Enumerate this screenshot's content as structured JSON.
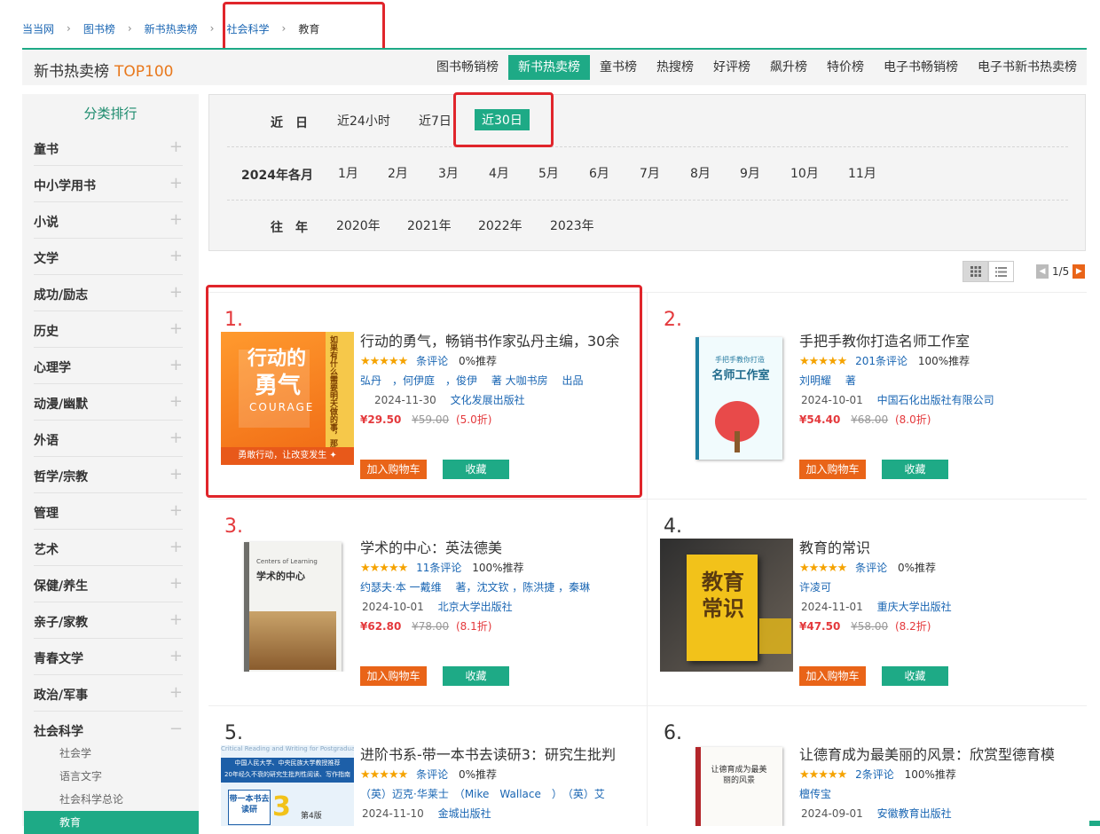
{
  "breadcrumb": [
    "当当网",
    "图书榜",
    "新书热卖榜",
    "社会科学",
    "教育"
  ],
  "header": {
    "title": "新书热卖榜",
    "top": "TOP100"
  },
  "tabs": [
    "图书畅销榜",
    "新书热卖榜",
    "童书榜",
    "热搜榜",
    "好评榜",
    "飙升榜",
    "特价榜",
    "电子书畅销榜",
    "电子书新书热卖榜"
  ],
  "active_tab": "新书热卖榜",
  "sidebar": {
    "title": "分类排行",
    "items": [
      "童书",
      "中小学用书",
      "小说",
      "文学",
      "成功/励志",
      "历史",
      "心理学",
      "动漫/幽默",
      "外语",
      "哲学/宗教",
      "管理",
      "艺术",
      "保健/养生",
      "亲子/家教",
      "青春文学",
      "政治/军事",
      "社会科学"
    ],
    "expanded": "社会科学",
    "subitems": [
      "社会学",
      "语言文字",
      "社会科学总论",
      "教育"
    ],
    "active_sub": "教育"
  },
  "filter": {
    "recent_label": "近　日",
    "recent": [
      "近24小时",
      "近7日",
      "近30日"
    ],
    "recent_active": "近30日",
    "month_label": "2024年各月",
    "months": [
      "1月",
      "2月",
      "3月",
      "4月",
      "5月",
      "6月",
      "7月",
      "8月",
      "9月",
      "10月",
      "11月"
    ],
    "year_label": "往　年",
    "years": [
      "2020年",
      "2021年",
      "2022年",
      "2023年"
    ]
  },
  "pager": {
    "text": "1/5"
  },
  "colors": {
    "accent": "#1eaa86",
    "price": "#e4393c",
    "cart": "#e96418",
    "highlight": "#e0252b"
  },
  "buttons": {
    "cart": "加入购物车",
    "fav": "收藏"
  },
  "books": [
    {
      "rank": "1.",
      "title": "行动的勇气，畅销书作家弘丹主编，30余",
      "rating": 5,
      "reviews": "条评论",
      "recommend": "0%推荐",
      "authors": "弘丹　，何伊庭　，俊伊　 著 大咖书房　 出品",
      "date": "2024-11-30",
      "publisher": "文化发展出版社",
      "price": "¥29.50",
      "orig": "¥59.00",
      "discount": "(5.0折)"
    },
    {
      "rank": "2.",
      "title": "手把手教你打造名师工作室",
      "rating": 5,
      "reviews": "201条评论",
      "recommend": "100%推荐",
      "authors": "刘明耀　 著",
      "date": "2024-10-01",
      "publisher": "中国石化出版社有限公司",
      "price": "¥54.40",
      "orig": "¥68.00",
      "discount": "(8.0折)"
    },
    {
      "rank": "3.",
      "title": "学术的中心：英法德美",
      "rating": 5,
      "reviews": "11条评论",
      "recommend": "100%推荐",
      "authors": "约瑟夫·本 一戴维　 著，沈文钦 ，陈洪捷 ，秦琳",
      "date": "2024-10-01",
      "publisher": "北京大学出版社",
      "price": "¥62.80",
      "orig": "¥78.00",
      "discount": "(8.1折)"
    },
    {
      "rank": "4.",
      "title": "教育的常识",
      "rating": 5,
      "reviews": "条评论",
      "recommend": "0%推荐",
      "authors": "许凌可",
      "date": "2024-11-01",
      "publisher": "重庆大学出版社",
      "price": "¥47.50",
      "orig": "¥58.00",
      "discount": "(8.2折)"
    },
    {
      "rank": "5.",
      "title": "进阶书系-带一本书去读研3：研究生批判",
      "rating": 5,
      "reviews": "条评论",
      "recommend": "0%推荐",
      "authors": "（英）迈克·华莱士　（Mike　Wallace　）　（英）艾",
      "date": "2024-11-10",
      "publisher": "金城出版社",
      "price": "",
      "orig": "",
      "discount": ""
    },
    {
      "rank": "6.",
      "title": "让德育成为最美丽的风景：欣赏型德育模",
      "rating": 5,
      "reviews": "2条评论",
      "recommend": "100%推荐",
      "authors": "檀传宝",
      "date": "2024-09-01",
      "publisher": "安徽教育出版社",
      "price": "",
      "orig": "",
      "discount": ""
    }
  ],
  "covers": {
    "b1": {
      "main": "行动的",
      "big": "勇气",
      "en": "COURAGE",
      "side": "如果有什么需要明天做的事，那就从现在开始吧",
      "band": "勇敢行动，让改变发生 ✦"
    },
    "b2": {
      "top": "手把手教你打造",
      "big": "名师工作室"
    },
    "b3": {
      "en": "Centers of Learning",
      "big": "学术的中心"
    },
    "b4": {
      "big": "教育常识"
    },
    "b5": {
      "band1": "中国人民大学、中央民族大学教授推荐",
      "band2": "20年经久不衰的研究生批判性阅读、写作指南",
      "big": "带一本书去读研",
      "num": "3",
      "ed": "第4版",
      "en": "Critical Reading and Writing for Postgraduates"
    },
    "b6": {
      "big": "让德育成为最美丽的风景"
    }
  }
}
